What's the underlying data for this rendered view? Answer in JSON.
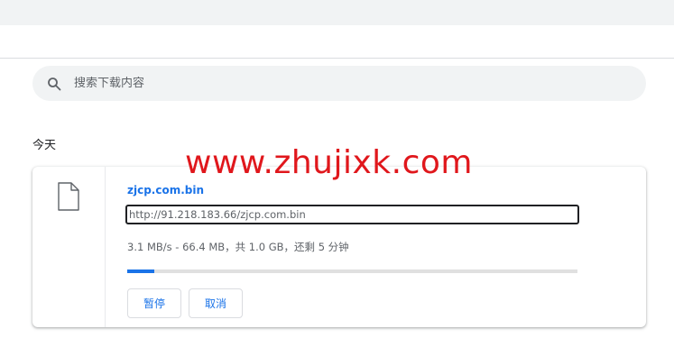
{
  "search": {
    "placeholder": "搜索下载内容"
  },
  "section": {
    "title": "今天"
  },
  "download": {
    "file_name": "zjcp.com.bin",
    "url": "http://91.218.183.66/zjcp.com.bin",
    "status": "3.1 MB/s - 66.4 MB，共 1.0 GB，还剩 5 分钟",
    "progress_fraction": 0.06,
    "pause_label": "暂停",
    "cancel_label": "取消"
  },
  "watermark": {
    "text": "www.zhujixk.com"
  },
  "colors": {
    "accent": "#1a73e8",
    "watermark": "#e0171c"
  },
  "icons": {
    "search": "search-icon",
    "file": "file-icon"
  }
}
